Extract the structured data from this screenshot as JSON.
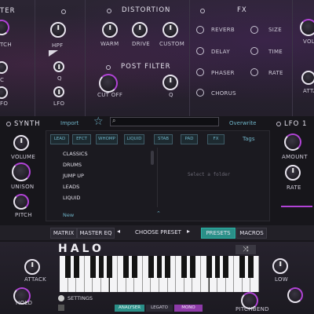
{
  "top": {
    "left_section_label": "TER",
    "left_knobs": [
      "TCH",
      "C",
      "FO"
    ],
    "mod_knobs": [
      "HPF",
      "Q",
      "LFO"
    ],
    "distortion": {
      "title": "DISTORTION",
      "knobs": [
        "WARM",
        "DRIVE",
        "CUSTOM"
      ]
    },
    "post_filter": {
      "title": "POST FILTER",
      "knobs": [
        "CUT OFF",
        "Q"
      ]
    },
    "fx": {
      "title": "FX",
      "left_items": [
        "REVERB",
        "DELAY",
        "PHASER",
        "CHORUS"
      ],
      "right_items": [
        "SIZE",
        "TIME",
        "RATE"
      ]
    },
    "right_cut_labels": [
      "VOLU",
      "ATTA"
    ]
  },
  "synth": {
    "title": "SYNTH",
    "knobs": [
      "VOLUME",
      "UNISON",
      "PITCH"
    ]
  },
  "browser": {
    "import_label": "Import",
    "overwrite_label": "Overwrite",
    "search_placeholder": "",
    "tags_label": "Tags",
    "tags": [
      "LEAD",
      "EFCT",
      "WHOMP",
      "LIQUID",
      "STAB",
      "PAD",
      "FX"
    ],
    "presets": [
      "CLASSICS",
      "DRUMS",
      "JUMP UP",
      "LEADS",
      "LIQUID"
    ],
    "detail_placeholder": "Select a folder",
    "new_label": "New"
  },
  "lfo": {
    "title": "LFO 1",
    "knobs": [
      "AMOUNT",
      "RATE"
    ]
  },
  "footer": {
    "matrix": "MATRIX",
    "master_eq": "MASTER EQ",
    "choose_preset": "CHOOSE PRESET",
    "presets": "PRESETS",
    "macros": "MACROS"
  },
  "bottom": {
    "logo": "HALO",
    "left_knobs": [
      "ATTACK",
      "HOLD"
    ],
    "settings": "SETTINGS",
    "right_knobs": [
      "LOW",
      "PITCHBEND"
    ],
    "modes": [
      "ANALYSER",
      "LEGATO",
      "MONO"
    ]
  },
  "colors": {
    "accent_purple": "#b143d6",
    "accent_teal": "#2bb3a6",
    "tag_text": "#6fb4c8"
  }
}
